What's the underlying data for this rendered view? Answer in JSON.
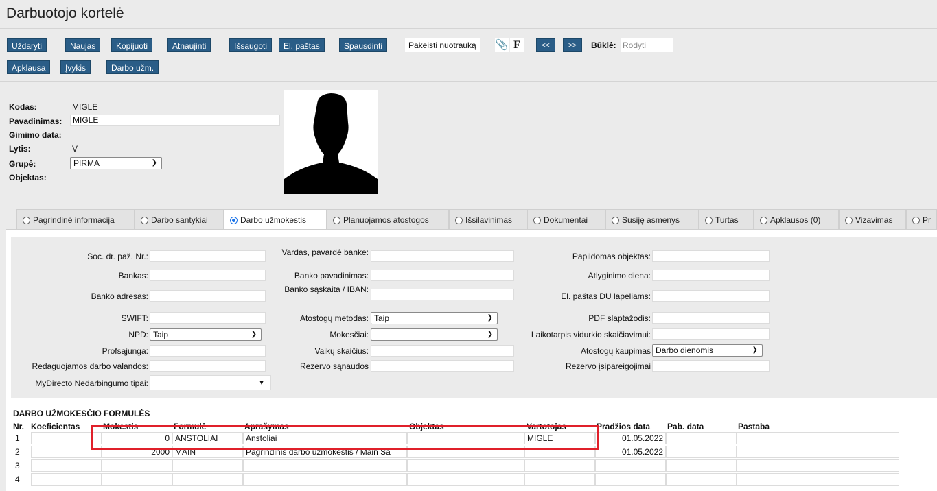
{
  "title": "Darbuotojo kortelė",
  "toolbar": {
    "close": "Uždaryti",
    "new": "Naujas",
    "copy": "Kopijuoti",
    "refresh": "Atnaujinti",
    "save": "Išsaugoti",
    "email": "El. paštas",
    "print": "Spausdinti",
    "change_photo": "Pakeisti nuotrauką",
    "f_label": "F",
    "prev": "<<",
    "next": ">>",
    "status_label": "Būklė:",
    "status_value": "Rodyti",
    "survey": "Apklausa",
    "event": "Įvykis",
    "salary": "Darbo užm."
  },
  "header": {
    "code_label": "Kodas:",
    "code_value": "MIGLE",
    "name_label": "Pavadinimas:",
    "name_value": "MIGLE",
    "birth_label": "Gimimo data:",
    "gender_label": "Lytis:",
    "gender_value": "V",
    "group_label": "Grupė:",
    "group_value": "PIRMA",
    "object_label": "Objektas:"
  },
  "tabs": [
    {
      "label": "Pagrindinė informacija"
    },
    {
      "label": "Darbo santykiai"
    },
    {
      "label": "Darbo užmokestis"
    },
    {
      "label": "Planuojamos atostogos"
    },
    {
      "label": "Išsilavinimas"
    },
    {
      "label": "Dokumentai"
    },
    {
      "label": "Susiję asmenys"
    },
    {
      "label": "Turtas"
    },
    {
      "label": "Apklausos (0)"
    },
    {
      "label": "Vizavimas"
    },
    {
      "label": "Pr"
    }
  ],
  "form": {
    "soc": "Soc. dr. paž. Nr.:",
    "bank": "Bankas:",
    "bank_addr": "Banko adresas:",
    "swift": "SWIFT:",
    "npd": "NPD:",
    "npd_value": "Taip",
    "union": "Profsąjunga:",
    "edit_hours": "Redaguojamos darbo valandos:",
    "mydirecto": "MyDirecto Nedarbingumo tipai:",
    "name_bank": "Vardas, pavardė banke:",
    "bank_name": "Banko pavadinimas:",
    "bank_account": "Banko sąskaita / IBAN:",
    "vac_method": "Atostogų metodas:",
    "vac_method_value": "Taip",
    "taxes": "Mokesčiai:",
    "children": "Vaikų skaičius:",
    "reserve_costs": "Rezervo sąnaudos",
    "extra_object": "Papildomas objektas:",
    "pay_day": "Atlyginimo diena:",
    "email_du": "El. paštas DU lapeliams:",
    "pdf_pwd": "PDF slaptažodis:",
    "avg_period": "Laikotarpis vidurkio skaičiavimui:",
    "vac_accum": "Atostogų kaupimas",
    "vac_accum_value": "Darbo dienomis",
    "reserve_obl": "Rezervo įsipareigojimai"
  },
  "formulas": {
    "section_title": "DARBO UŽMOKESČIO FORMULĖS",
    "headers": [
      "Nr.",
      "Koeficientas",
      "Mokestis",
      "Formulė",
      "Aprašymas",
      "Objektas",
      "Vartotojas",
      "Pradžios data",
      "Pab. data",
      "Pastaba"
    ],
    "rows": [
      {
        "nr": "1",
        "coef": "",
        "tax": "0",
        "formula": "ANSTOLIAI",
        "desc": "Anstoliai",
        "object": "",
        "user": "MIGLE",
        "start": "01.05.2022",
        "end": "",
        "note": ""
      },
      {
        "nr": "2",
        "coef": "",
        "tax": "2000",
        "formula": "MAIN",
        "desc": "Pagrindinis darbo užmokestis / Main Sa",
        "object": "",
        "user": "",
        "start": "01.05.2022",
        "end": "",
        "note": ""
      },
      {
        "nr": "3",
        "coef": "",
        "tax": "",
        "formula": "",
        "desc": "",
        "object": "",
        "user": "",
        "start": "",
        "end": "",
        "note": ""
      },
      {
        "nr": "4",
        "coef": "",
        "tax": "",
        "formula": "",
        "desc": "",
        "object": "",
        "user": "",
        "start": "",
        "end": "",
        "note": ""
      }
    ]
  },
  "colors": {
    "button": "#2a5d87",
    "highlight": "#e0202a",
    "radio": "#1a73e8"
  }
}
